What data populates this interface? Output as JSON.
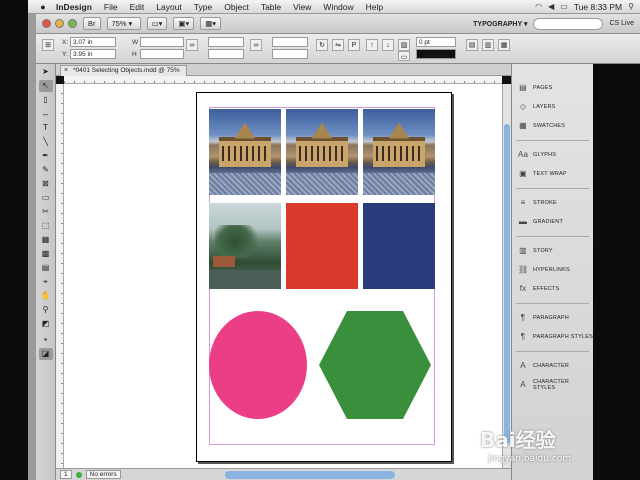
{
  "menubar": {
    "app_name": "InDesign",
    "items": [
      "File",
      "Edit",
      "Layout",
      "Type",
      "Object",
      "Table",
      "View",
      "Window",
      "Help"
    ],
    "clock": "Tue 8:33 PM"
  },
  "appbar": {
    "zoom": "75%",
    "workspace": "TYPOGRAPHY ▾",
    "cs_live": "CS Live"
  },
  "controlpanel": {
    "x_label": "X:",
    "x_value": "3.07 in",
    "y_label": "Y:",
    "y_value": "3.95 in",
    "stroke_weight": "0 pt"
  },
  "document": {
    "tab_title": "*0401 Selecting Objects.indd @ 75%"
  },
  "tools": [
    "selection",
    "direct-selection",
    "page",
    "gap",
    "type",
    "line",
    "pen",
    "pencil",
    "rectangle-frame",
    "rectangle",
    "scissors",
    "free-transform",
    "gradient-swatch",
    "gradient-feather",
    "note",
    "eyedropper",
    "hand",
    "zoom",
    "fill-stroke",
    "apply-color",
    "view-mode"
  ],
  "panels": {
    "groups": [
      [
        "PAGES",
        "LAYERS",
        "SWATCHES"
      ],
      [
        "GLYPHS",
        "TEXT WRAP"
      ],
      [
        "STROKE",
        "GRADIENT"
      ],
      [
        "STORY",
        "HYPERLINKS",
        "EFFECTS"
      ],
      [
        "PARAGRAPH",
        "PARAGRAPH STYLES"
      ],
      [
        "CHARACTER",
        "CHARACTER STYLES"
      ]
    ]
  },
  "statusbar": {
    "page_number": "1",
    "preflight": "No errors"
  },
  "watermark": {
    "brand": "Bai经验",
    "url": "jingyan.baidu.com"
  }
}
